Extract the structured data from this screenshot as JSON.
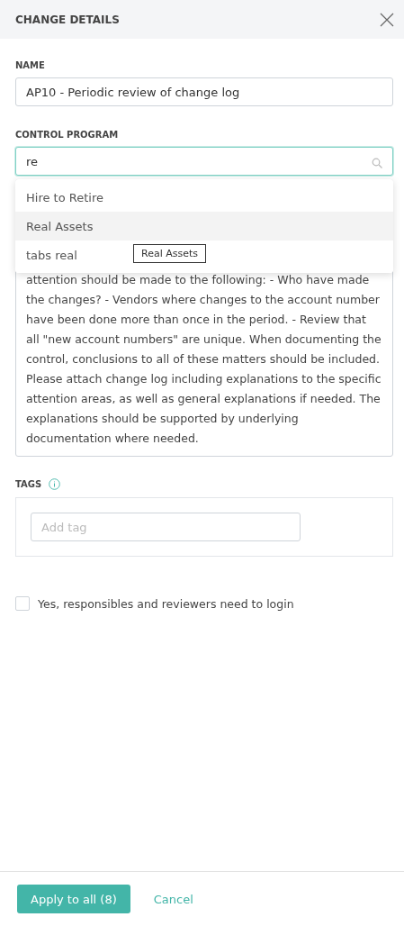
{
  "header": {
    "title": "CHANGE DETAILS"
  },
  "name_field": {
    "label": "NAME",
    "value": "AP10 - Periodic review of change log"
  },
  "control_program": {
    "label": "CONTROL PROGRAM",
    "value": "re",
    "options": [
      {
        "label": "Hire to Retire",
        "selected": false
      },
      {
        "label": "Real Assets",
        "selected": true
      },
      {
        "label": "tabs real",
        "selected": false
      }
    ],
    "tooltip": "Real Assets"
  },
  "description": "attention should be made to the following: - Who have made the changes? - Vendors where changes to the account number have been done more than once in the period. - Review that all \"new account numbers\" are unique. When documenting the control, conclusions to all of these matters should be included. Please attach change log including explanations to the specific attention areas, as well as general explanations if needed. The explanations should be supported by underlying documentation where needed.",
  "tags": {
    "label": "TAGS",
    "placeholder": "Add tag"
  },
  "login_checkbox": {
    "label": "Yes, responsibles and reviewers need to login",
    "checked": false
  },
  "footer": {
    "primary": "Apply to all (8)",
    "secondary": "Cancel"
  }
}
